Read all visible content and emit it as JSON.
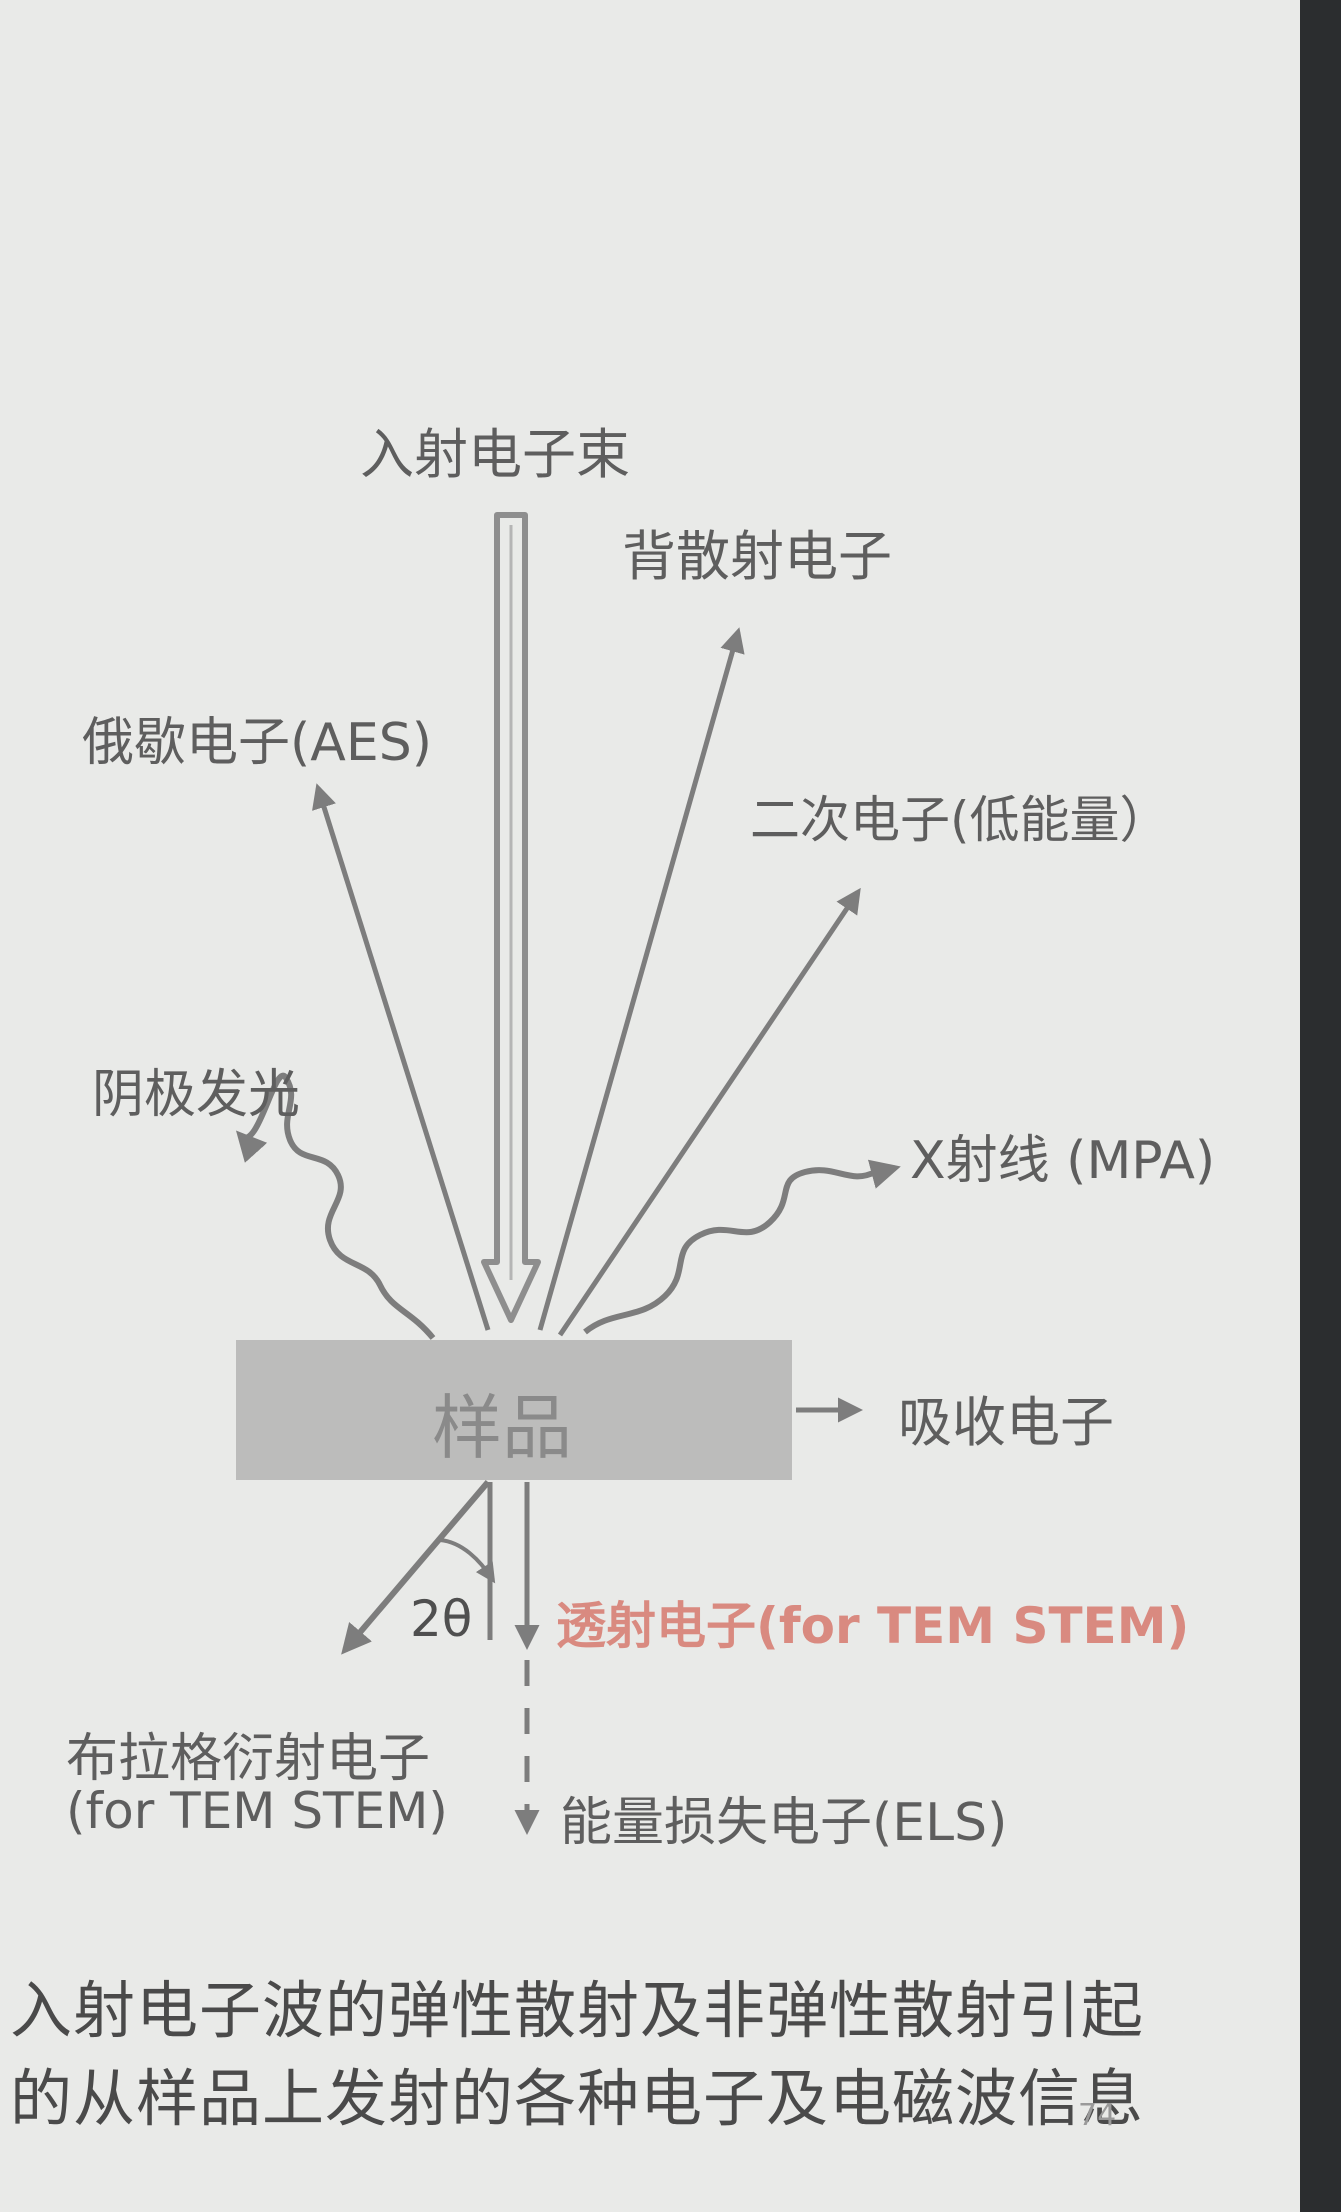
{
  "diagram": {
    "incident_beam": "入射电子束",
    "backscattered": "背散射电子",
    "auger": "俄歇电子(AES)",
    "secondary": "二次电子(低能量）",
    "cathodoluminescence": "阴极发光",
    "xray": "X射线 (MPA)",
    "sample": "样品",
    "absorbed": "吸收电子",
    "angle": "2θ",
    "transmitted": "透射电子(for TEM STEM)",
    "bragg_line1": "布拉格衍射电子",
    "bragg_line2": "(for TEM STEM)",
    "energy_loss": "能量损失电子(ELS)",
    "caption_line1": "入射电子波的弹性散射及非弹性散射引起",
    "caption_line2": "的从样品上发射的各种电子及电磁波信息",
    "page_number": "74"
  },
  "colors": {
    "background": "#e9eae8",
    "arrow": "#7d7d7d",
    "text": "#5e5e5e",
    "sample": "#bcbcbb",
    "highlight": "#d98a80"
  }
}
